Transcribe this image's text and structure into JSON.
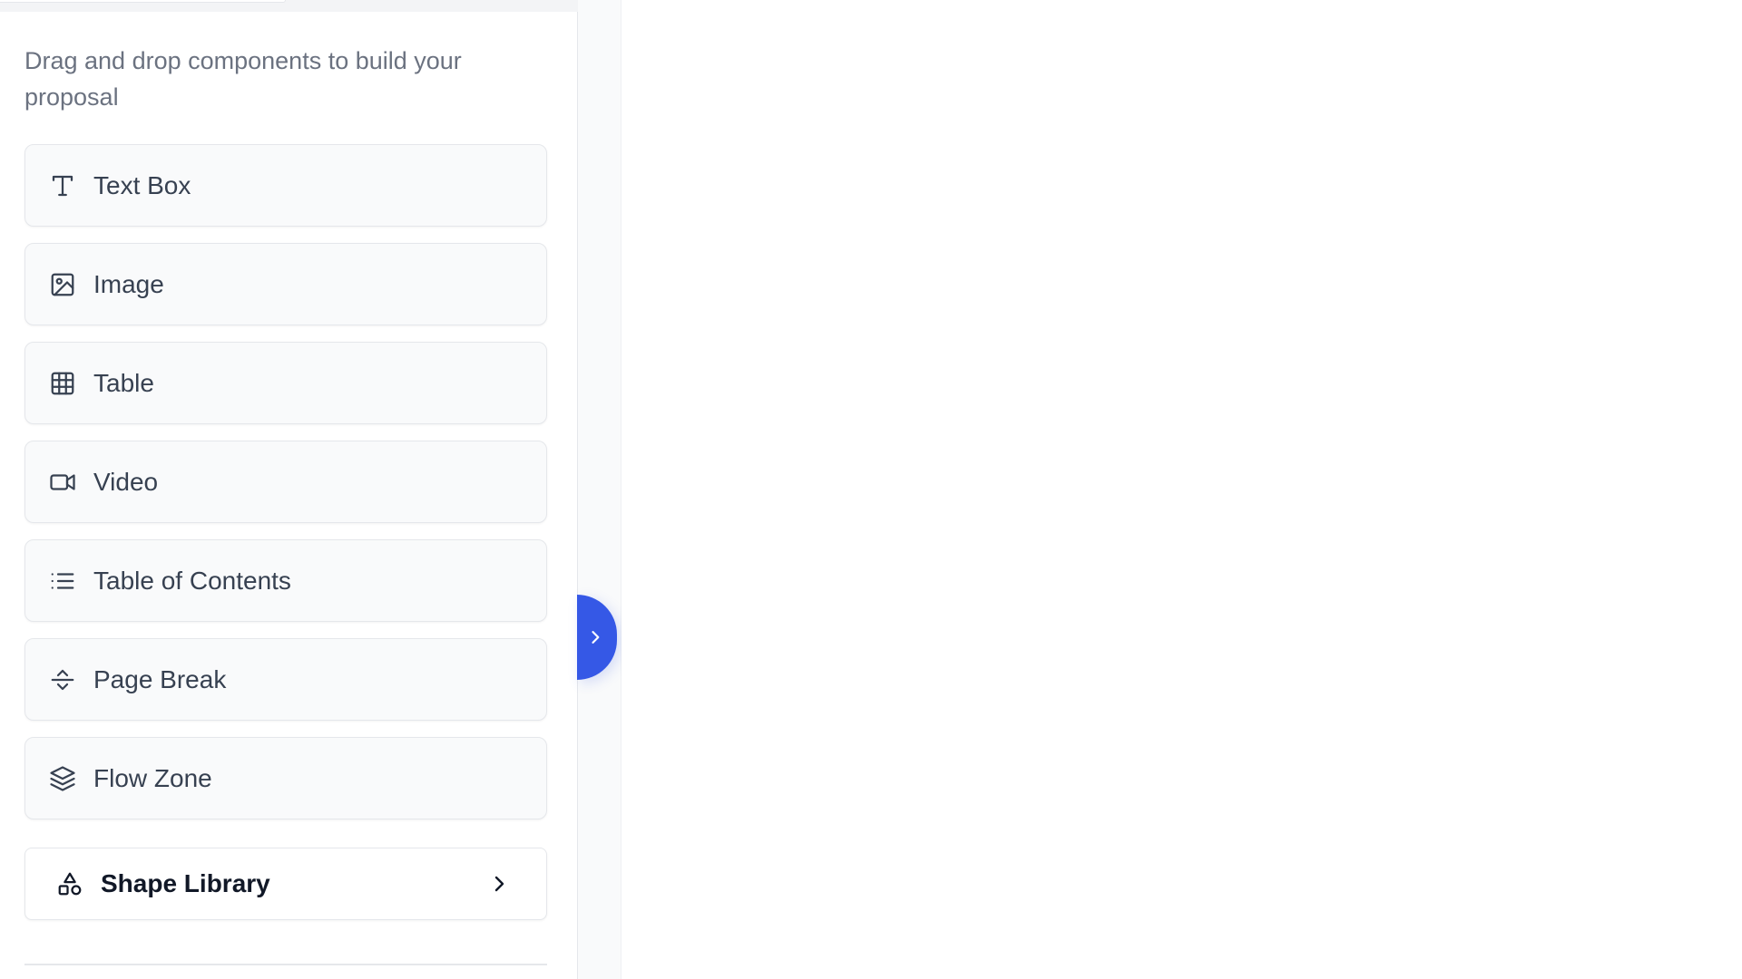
{
  "sidebar": {
    "description": "Drag and drop components to build your proposal",
    "components": [
      {
        "label": "Text Box",
        "icon": "text-icon"
      },
      {
        "label": "Image",
        "icon": "image-icon"
      },
      {
        "label": "Table",
        "icon": "table-icon"
      },
      {
        "label": "Video",
        "icon": "video-icon"
      },
      {
        "label": "Table of Contents",
        "icon": "list-icon"
      },
      {
        "label": "Page Break",
        "icon": "page-break-icon"
      },
      {
        "label": "Flow Zone",
        "icon": "layers-icon"
      }
    ],
    "shape_library": {
      "label": "Shape Library",
      "icon": "shapes-icon",
      "chevron_icon": "chevron-right-icon"
    }
  },
  "toggle": {
    "icon": "chevron-right-icon",
    "color": "#3558e6"
  },
  "colors": {
    "accent": "#3558e6",
    "text_primary": "#374151",
    "text_muted": "#6b7280",
    "border": "#e5e7eb",
    "item_background": "#f9fafb"
  }
}
